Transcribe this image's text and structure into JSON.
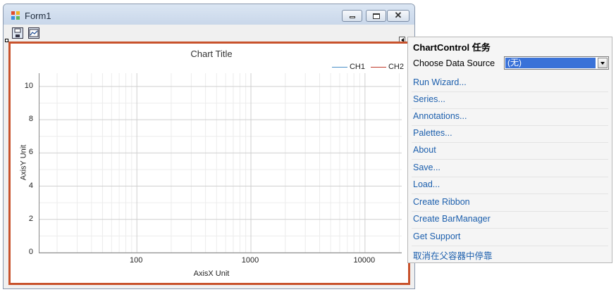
{
  "window": {
    "title": "Form1",
    "close_glyph": "✕"
  },
  "toolbar": {
    "icons": [
      "save-icon",
      "chart-icon"
    ]
  },
  "chart_data": {
    "type": "line",
    "title": "Chart Title",
    "xlabel": "AxisX Unit",
    "ylabel": "AxisY Unit",
    "x_scale": "log",
    "x_ticks": [
      "100",
      "1000",
      "10000"
    ],
    "y_ticks": [
      "0",
      "2",
      "4",
      "6",
      "8",
      "10"
    ],
    "ylim": [
      0,
      10.8
    ],
    "grid": true,
    "legend_position": "top-right",
    "series": [
      {
        "name": "CH1",
        "color": "#4a90c8",
        "values": []
      },
      {
        "name": "CH2",
        "color": "#c0392b",
        "values": []
      }
    ]
  },
  "tasks": {
    "header": "ChartControl 任务",
    "data_source_label": "Choose Data Source",
    "data_source_value": "(无)",
    "links": [
      "Run Wizard...",
      "Series...",
      "Annotations...",
      "Palettes...",
      "About",
      "Save...",
      "Load...",
      "Create Ribbon",
      "Create BarManager",
      "Get Support",
      "取消在父容器中停靠"
    ]
  },
  "colors": {
    "chart_border": "#c8522c",
    "link": "#1c5fad",
    "selection": "#3a72d8"
  }
}
